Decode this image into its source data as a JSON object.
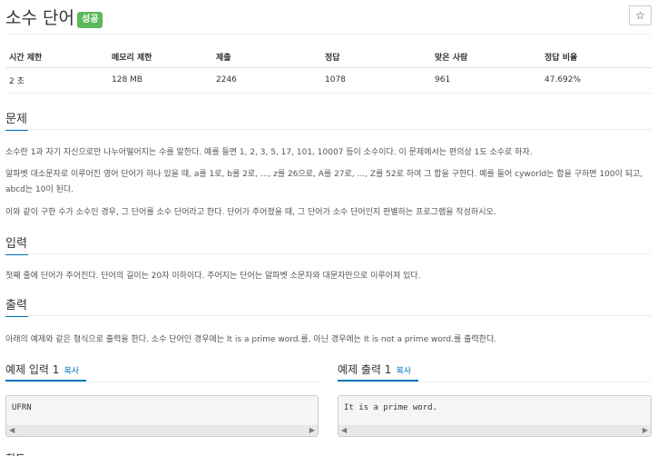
{
  "problem": {
    "title": "소수 단어",
    "badge": "성공",
    "star": "☆"
  },
  "stats": {
    "headers": [
      "시간 제한",
      "메모리 제한",
      "제출",
      "정답",
      "맞은 사람",
      "정답 비율"
    ],
    "values": [
      "2 초",
      "128 MB",
      "2246",
      "1078",
      "961",
      "47.692%"
    ]
  },
  "sections": {
    "problem_title": "문제",
    "problem_p1": "소수란 1과 자기 자신으로만 나누어떨어지는 수를 말한다. 예를 들면 1, 2, 3, 5, 17, 101, 10007 등이 소수이다. 이 문제에서는 편의상 1도 소수로 하자.",
    "problem_p2": "알파벳 대소문자로 이루어진 영어 단어가 하나 있을 때, a를 1로, b를 2로, ..., z를 26으로, A를 27로, ..., Z를 52로 하여 그 합을 구한다. 예를 들어 cyworld는 합을 구하면 100이 되고, abcd는 10이 된다.",
    "problem_p3": "이와 같이 구한 수가 소수인 경우, 그 단어를 소수 단어라고 한다. 단어가 주어졌을 때, 그 단어가 소수 단어인지 판별하는 프로그램을 작성하시오.",
    "input_title": "입력",
    "input_p": "첫째 줄에 단어가 주어진다. 단어의 길이는 20자 이하이다. 주어지는 단어는 알파벳 소문자와 대문자만으로 이루어져 있다.",
    "output_title": "출력",
    "output_p": "아래의 예제와 같은 형식으로 출력을 한다. 소수 단어인 경우에는 It is a prime word.를, 아닌 경우에는 It is not a prime word.를 출력한다."
  },
  "examples": {
    "input_title": "예제 입력 1",
    "input_copy": "복사",
    "input_value": "UFRN",
    "output_title": "예제 출력 1",
    "output_copy": "복사",
    "output_value": "It is a prime word.",
    "arrow_left": "◀",
    "arrow_right": "▶"
  },
  "next_section_partial": "힌트"
}
